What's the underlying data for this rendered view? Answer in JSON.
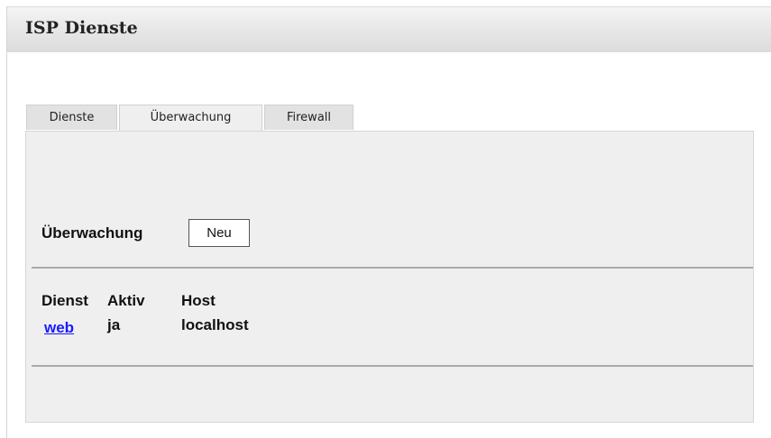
{
  "header": {
    "title": "ISP Dienste"
  },
  "tabs": [
    {
      "label": "Dienste",
      "active": false
    },
    {
      "label": "Überwachung",
      "active": true
    },
    {
      "label": "Firewall",
      "active": false
    }
  ],
  "section": {
    "title": "Überwachung",
    "new_button": "Neu"
  },
  "table": {
    "columns": [
      "Dienst",
      "Aktiv",
      "Host"
    ],
    "rows": [
      {
        "dienst": "web",
        "aktiv": "ja",
        "host": "localhost"
      }
    ]
  },
  "colors": {
    "link": "#1a1aff",
    "content_bg": "#efefef",
    "header_bg": "#e6e6e6"
  }
}
